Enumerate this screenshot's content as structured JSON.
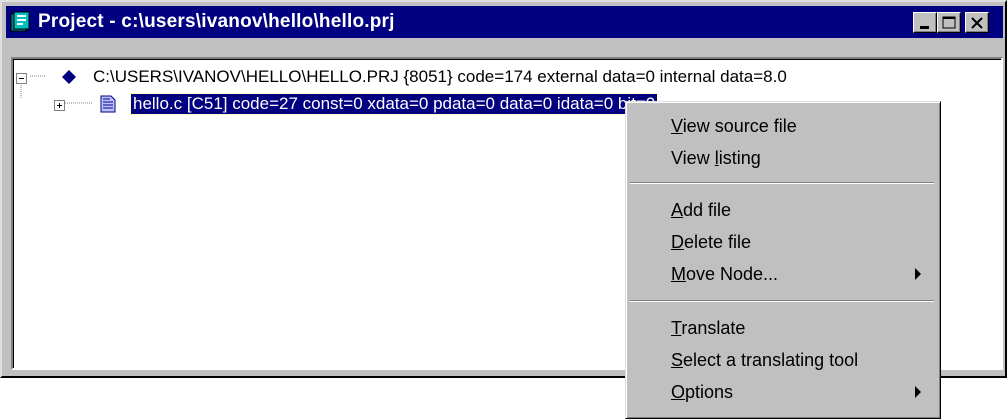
{
  "window": {
    "title": "Project - c:\\users\\ivanov\\hello\\hello.prj"
  },
  "tree": {
    "root": {
      "label": "C:\\USERS\\IVANOV\\HELLO\\HELLO.PRJ {8051} code=174  external data=0  internal data=8.0",
      "expander": "minus"
    },
    "child": {
      "label": "hello.c [C51] code=27 const=0 xdata=0 pdata=0 data=0 idata=0 bit=0",
      "expander": "plus",
      "selected": true
    }
  },
  "context_menu": {
    "items": [
      {
        "pre": "",
        "u": "V",
        "post": "iew source file",
        "submenu": false
      },
      {
        "pre": "View ",
        "u": "l",
        "post": "isting",
        "submenu": false
      },
      {
        "pre": "",
        "u": "A",
        "post": "dd file",
        "submenu": false
      },
      {
        "pre": "",
        "u": "D",
        "post": "elete file",
        "submenu": false
      },
      {
        "pre": "",
        "u": "M",
        "post": "ove Node...",
        "submenu": true
      },
      {
        "pre": "",
        "u": "T",
        "post": "ranslate",
        "submenu": false
      },
      {
        "pre": "",
        "u": "S",
        "post": "elect a translating tool",
        "submenu": false
      },
      {
        "pre": "",
        "u": "O",
        "post": "ptions",
        "submenu": true
      }
    ]
  },
  "colors": {
    "titlebar": "#000080",
    "face": "#c0c0c0",
    "selection": "#000080"
  }
}
